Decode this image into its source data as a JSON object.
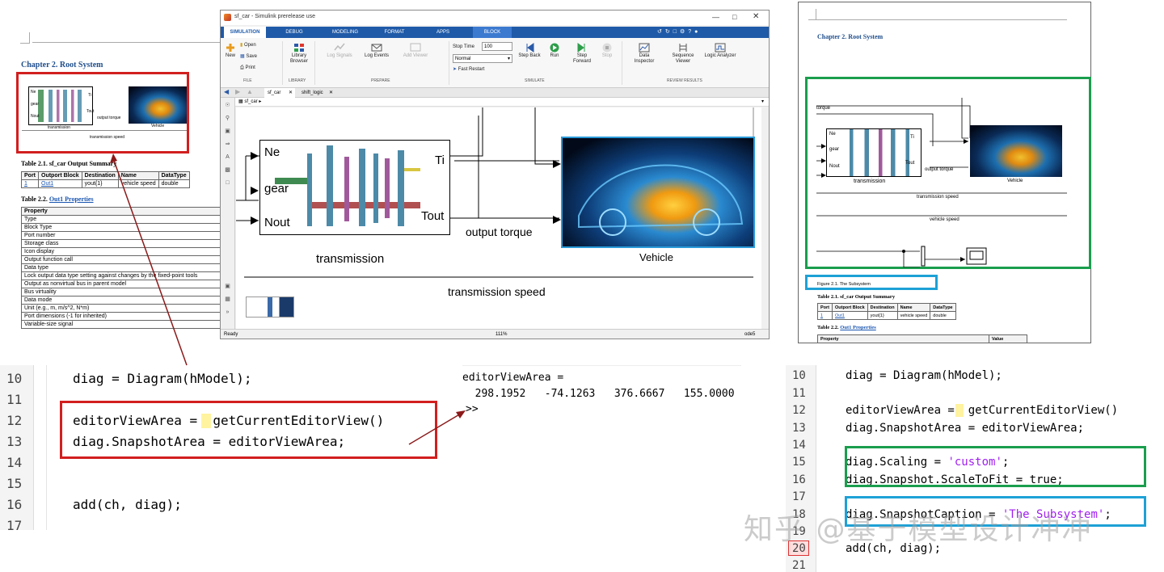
{
  "left_doc": {
    "chapter": "Chapter 2. Root System",
    "thumb": {
      "ne": "Ne",
      "gear": "gear",
      "nout": "Nout",
      "ti": "Ti",
      "tout": "Tout",
      "transmission": "transmission",
      "output_torque": "output torque",
      "vehicle": "Vehicle",
      "speed": "transmission speed"
    },
    "table1_caption": "Table 2.1. sf_car Output Summary",
    "table1": {
      "headers": [
        "Port",
        "Outport Block",
        "Destination",
        "Name",
        "DataType"
      ],
      "row": [
        "1",
        "Out1",
        "yout{1}",
        "vehicle speed",
        "double"
      ]
    },
    "table2_caption_prefix": "Table 2.2.",
    "table2_caption_link": "Out1 Properties",
    "table2_header": "Property",
    "properties": [
      "Type",
      "Block Type",
      "Port number",
      "Storage class",
      "Icon display",
      "Output function call",
      "Data type",
      "Lock output data type setting against changes by the fixed-point tools",
      "Output as nonvirtual bus in parent model",
      "Bus virtuality",
      "Data mode",
      "Unit (e.g., m, m/s^2, N*m)",
      "Port dimensions (-1 for inherited)",
      "Variable-size signal"
    ]
  },
  "simulink": {
    "title": "sf_car - Simulink prerelease use",
    "tabs": [
      "SIMULATION",
      "DEBUG",
      "MODELING",
      "FORMAT",
      "APPS",
      "BLOCK"
    ],
    "file": {
      "new": "New",
      "open": "Open",
      "save": "Save",
      "print": "Print",
      "group": "FILE"
    },
    "library": {
      "browser": "Library Browser",
      "group": "LIBRARY"
    },
    "prepare": {
      "log_signals": "Log Signals",
      "log_events": "Log Events",
      "add_viewer": "Add Viewer",
      "group": "PREPARE"
    },
    "simulate": {
      "stop_time_label": "Stop Time",
      "stop_time_value": "100",
      "mode": "Normal",
      "fast_restart": "Fast Restart",
      "step_back": "Step Back",
      "run": "Run",
      "step_forward": "Step Forward",
      "stop": "Stop",
      "group": "SIMULATE"
    },
    "review": {
      "data_inspector": "Data Inspector",
      "sequence_viewer": "Sequence Viewer",
      "logic_analyzer": "Logic Analyzer",
      "group": "REVIEW RESULTS"
    },
    "doc_tabs": [
      "sf_car",
      "shift_logic"
    ],
    "breadcrumb": "sf_car",
    "canvas": {
      "ne": "Ne",
      "gear": "gear",
      "nout": "Nout",
      "ti": "Ti",
      "tout": "Tout",
      "transmission": "transmission",
      "output_torque": "output torque",
      "vehicle": "Vehicle",
      "speed": "transmission speed"
    },
    "status": {
      "ready": "Ready",
      "zoom": "111%",
      "solver": "ode5"
    }
  },
  "right_doc": {
    "chapter": "Chapter 2. Root System",
    "torque": "torque",
    "ne": "Ne",
    "gear": "gear",
    "nout": "Nout",
    "ti": "Ti",
    "tout": "Tout",
    "transmission": "transmission",
    "output_torque": "output torque",
    "vehicle": "Vehicle",
    "speed1": "transmission speed",
    "speed2": "vehicle speed",
    "figure_caption": "Figure 2.1. The Subsystem",
    "table1_caption": "Table 2.1. sf_car Output Summary",
    "table1_headers": [
      "Port",
      "Outport Block",
      "Destination",
      "Name",
      "DataType"
    ],
    "table1_row": [
      "1",
      "Out1",
      "yout{1}",
      "vehicle speed",
      "double"
    ],
    "table2_caption_prefix": "Table 2.2.",
    "table2_caption_link": "Out1 Properties",
    "table2_headers": [
      "Property",
      "Value"
    ]
  },
  "code_left": {
    "lines": [
      {
        "n": "10",
        "code": "diag = Diagram(hModel);"
      },
      {
        "n": "11",
        "code": ""
      },
      {
        "n": "12",
        "code": "editorViewArea =  getCurrentEditorView()"
      },
      {
        "n": "13",
        "code": "diag.SnapshotArea = editorViewArea;"
      },
      {
        "n": "14",
        "code": ""
      },
      {
        "n": "15",
        "code": ""
      },
      {
        "n": "16",
        "code": "add(ch, diag);"
      },
      {
        "n": "17",
        "code": ""
      }
    ]
  },
  "console": {
    "line1": "editorViewArea =",
    "line2": "  298.1952   -74.1263   376.6667   155.0000",
    "prompt": ">>"
  },
  "code_right": {
    "lines": [
      {
        "n": "10",
        "code": "diag = Diagram(hModel);"
      },
      {
        "n": "11",
        "code": ""
      },
      {
        "n": "12",
        "code": "editorViewArea =  getCurrentEditorView()"
      },
      {
        "n": "13",
        "code": "diag.SnapshotArea = editorViewArea;"
      },
      {
        "n": "14",
        "code": ""
      },
      {
        "n": "15",
        "code": "diag.Scaling = ",
        "str": "'custom'",
        "tail": ";"
      },
      {
        "n": "16",
        "code": "diag.Snapshot.ScaleToFit = true;"
      },
      {
        "n": "17",
        "code": ""
      },
      {
        "n": "18",
        "code": "diag.SnapshotCaption = ",
        "str": "'The Subsystem'",
        "tail": ";"
      },
      {
        "n": "19",
        "code": ""
      },
      {
        "n": "20",
        "code": "add(ch, diag);"
      },
      {
        "n": "21",
        "code": ""
      }
    ]
  },
  "watermark": "知乎 @基于模型设计冲冲",
  "colors": {
    "red_box": "#d21f1f",
    "green_box": "#1a9e4e",
    "cyan_box": "#1ea1d6",
    "ribbon_blue": "#1f5aa8",
    "chapter_blue": "#1f4e8c"
  }
}
